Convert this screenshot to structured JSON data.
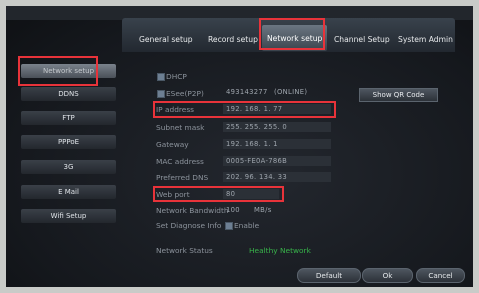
{
  "tabs": [
    {
      "label": "General setup"
    },
    {
      "label": "Record setup"
    },
    {
      "label": "Network setup"
    },
    {
      "label": "Channel Setup"
    },
    {
      "label": "System Admin"
    }
  ],
  "sidebar": {
    "items": [
      {
        "label": "Network setup"
      },
      {
        "label": "DDNS"
      },
      {
        "label": "FTP"
      },
      {
        "label": "PPPoE"
      },
      {
        "label": "3G"
      },
      {
        "label": "E Mail"
      },
      {
        "label": "Wifi Setup"
      }
    ]
  },
  "form": {
    "dhcp_label": "DHCP",
    "dhcp_checked": false,
    "esee_label": "ESee(P2P)",
    "esee_checked": true,
    "esee_id": "493143277",
    "esee_status": "(ONLINE)",
    "show_qr_label": "Show QR Code",
    "ip_label": "IP address",
    "ip_value": "192. 168.   1.  77",
    "subnet_label": "Subnet mask",
    "subnet_value": "255. 255. 255.   0",
    "gateway_label": "Gateway",
    "gateway_value": "192. 168.   1.   1",
    "mac_label": "MAC address",
    "mac_value": "0005-FE0A-786B",
    "dns_label": "Preferred DNS",
    "dns_value": "202. 96. 134. 33",
    "webport_label": "Web port",
    "webport_value": "80",
    "bandwidth_label": "Network Bandwidth",
    "bandwidth_value": "100",
    "bandwidth_unit": "MB/s",
    "diagnose_label": "Set Diagnose Info",
    "diagnose_enable_label": "Enable",
    "diagnose_checked": true,
    "status_label": "Network Status",
    "status_value": "Healthy Network"
  },
  "buttons": {
    "default_label": "Default",
    "ok_label": "Ok",
    "cancel_label": "Cancel"
  },
  "colors": {
    "highlight": "#e8333a",
    "status_ok": "#38b44a"
  }
}
